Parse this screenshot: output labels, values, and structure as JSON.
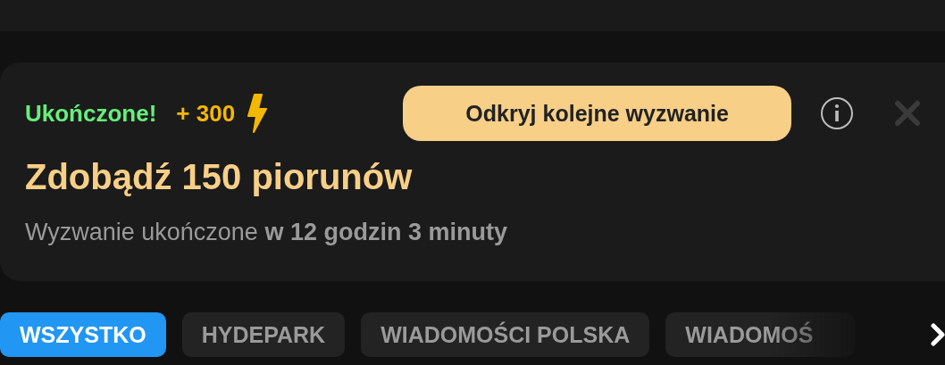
{
  "challenge": {
    "status": "Ukończone!",
    "points": "+ 300",
    "action": "Odkryj kolejne wyzwanie",
    "title": "Zdobądź 150 piorunów",
    "subtitle": "Wyzwanie ukończone **w 12 godzin 3 minuty**"
  },
  "categories": [
    {
      "label": "WSZYSTKO",
      "selected": true
    },
    {
      "label": "HYDEPARK",
      "selected": false
    },
    {
      "label": "WIADOMOŚCI POLSKA",
      "selected": false
    },
    {
      "label": "WIADOMOŚ",
      "selected": false
    }
  ]
}
